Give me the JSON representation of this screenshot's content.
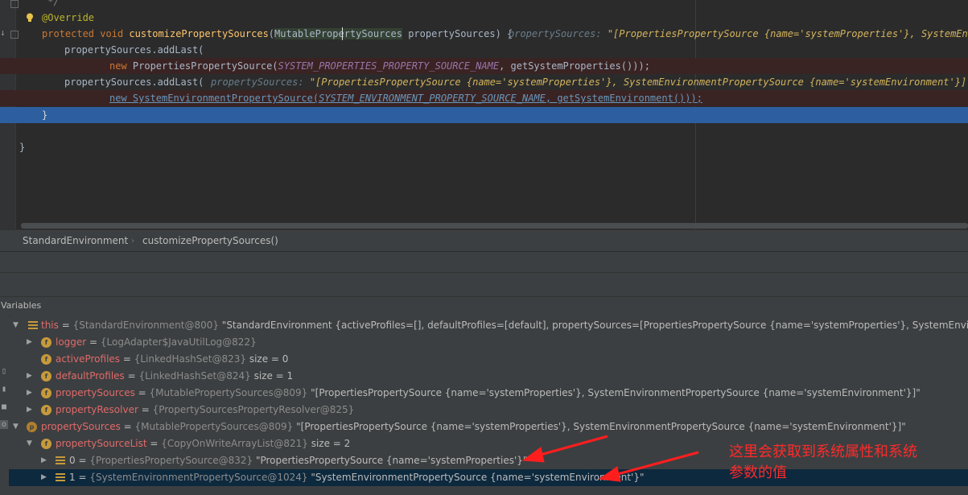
{
  "editor": {
    "lines": {
      "comment_end": " */",
      "override": "@Override",
      "sig_kw1": "protected",
      "sig_kw2": "void",
      "sig_fn": "customizePropertySources",
      "sig_paren": "(",
      "sig_type": "MutablePropertySources",
      "sig_rest": " propertySources) {",
      "sig_hint_name": "propertySources:",
      "sig_hint_value": " \"[PropertiesPropertySource {name='systemProperties'}, SystemEnvir",
      "add1": "propertySources.addLast(",
      "new1_kw": "new",
      "new1_class": " PropertiesPropertySource(",
      "new1_const": "SYSTEM_PROPERTIES_PROPERTY_SOURCE_NAME",
      "new1_rest": ", getSystemProperties()));",
      "add2": "propertySources.addLast(",
      "add2_hint_name": "propertySources:",
      "add2_hint_value": " \"[PropertiesPropertySource {name='systemProperties'}, SystemEnvironmentPropertySource {name='systemEnvironment'}]\"",
      "new2_kw": "new",
      "new2_class": " SystemEnvironmentPropertySource(",
      "new2_const": "SYSTEM_ENVIRONMENT_PROPERTY_SOURCE_NAME",
      "new2_rest": ", getSystemEnvironment()));",
      "close_method": "}",
      "close_class": "}"
    }
  },
  "breadcrumb": {
    "items": [
      "StandardEnvironment",
      "customizePropertySources()"
    ]
  },
  "variables_panel": {
    "title": "Variables",
    "rows": [
      {
        "name": "this",
        "eq": " = ",
        "ref": "{StandardEnvironment@800}",
        "value": " \"StandardEnvironment {activeProfiles=[], defaultProfiles=[default], propertySources=[PropertiesPropertySource {name='systemProperties'}, SystemEnvironmentPro"
      },
      {
        "name": "logger",
        "eq": " = ",
        "ref": "{LogAdapter$JavaUtilLog@822}",
        "value": ""
      },
      {
        "name": "activeProfiles",
        "eq": " = ",
        "ref": "{LinkedHashSet@823}",
        "value": "  size = 0"
      },
      {
        "name": "defaultProfiles",
        "eq": " = ",
        "ref": "{LinkedHashSet@824}",
        "value": "  size = 1"
      },
      {
        "name": "propertySources",
        "eq": " = ",
        "ref": "{MutablePropertySources@809}",
        "value": " \"[PropertiesPropertySource {name='systemProperties'}, SystemEnvironmentPropertySource {name='systemEnvironment'}]\""
      },
      {
        "name": "propertyResolver",
        "eq": " = ",
        "ref": "{PropertySourcesPropertyResolver@825}",
        "value": ""
      },
      {
        "name": "propertySources",
        "eq": " = ",
        "ref": "{MutablePropertySources@809}",
        "value": " \"[PropertiesPropertySource {name='systemProperties'}, SystemEnvironmentPropertySource {name='systemEnvironment'}]\""
      },
      {
        "name": "propertySourceList",
        "eq": " = ",
        "ref": "{CopyOnWriteArrayList@821}",
        "value": "  size = 2"
      },
      {
        "name": "0",
        "eq": " = ",
        "ref": "{PropertiesPropertySource@832}",
        "value": " \"PropertiesPropertySource {name='systemProperties'}\""
      },
      {
        "name": "1",
        "eq": " = ",
        "ref": "{SystemEnvironmentPropertySource@1024}",
        "value": " \"SystemEnvironmentPropertySource {name='systemEnvironment'}\""
      }
    ]
  },
  "annotation": {
    "line1": "这里会获取到系统属性和系统",
    "line2": "参数的值"
  },
  "colors": {
    "editor_bg": "#2b2b2b",
    "panel_bg": "#3c3f41",
    "current_line": "#2d5fa0",
    "breakpoint_line": "#3a2323",
    "selected_row": "#0d293e",
    "annotation": "#ff2a2a"
  }
}
